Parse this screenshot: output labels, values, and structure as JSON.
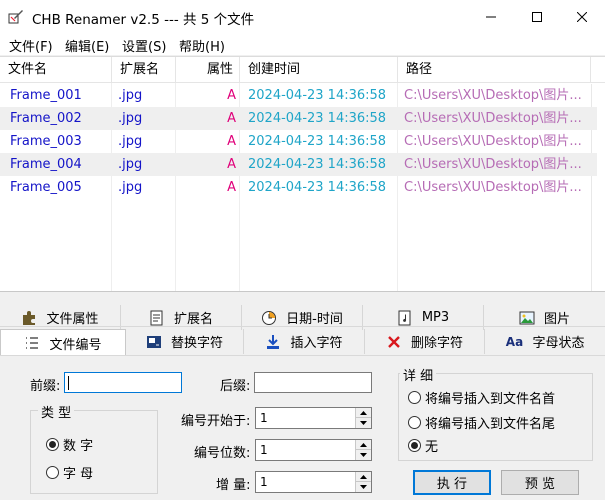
{
  "window": {
    "title": "CHB Renamer v2.5 --- 共 5 个文件"
  },
  "menu": {
    "items": [
      "文件(F)",
      "编辑(E)",
      "设置(S)",
      "帮助(H)"
    ]
  },
  "list": {
    "columns": [
      "文件名",
      "扩展名",
      "属性",
      "创建时间",
      "路径"
    ],
    "rows": [
      {
        "name": "Frame_001",
        "ext": ".jpg",
        "attr": "A",
        "time": "2024-04-23 14:36:58",
        "path": "C:\\Users\\XU\\Desktop\\图片..."
      },
      {
        "name": "Frame_002",
        "ext": ".jpg",
        "attr": "A",
        "time": "2024-04-23 14:36:58",
        "path": "C:\\Users\\XU\\Desktop\\图片..."
      },
      {
        "name": "Frame_003",
        "ext": ".jpg",
        "attr": "A",
        "time": "2024-04-23 14:36:58",
        "path": "C:\\Users\\XU\\Desktop\\图片..."
      },
      {
        "name": "Frame_004",
        "ext": ".jpg",
        "attr": "A",
        "time": "2024-04-23 14:36:58",
        "path": "C:\\Users\\XU\\Desktop\\图片..."
      },
      {
        "name": "Frame_005",
        "ext": ".jpg",
        "attr": "A",
        "time": "2024-04-23 14:36:58",
        "path": "C:\\Users\\XU\\Desktop\\图片..."
      }
    ]
  },
  "tabs": {
    "row1": [
      {
        "label": "文件属性",
        "icon": "puzzle-icon"
      },
      {
        "label": "扩展名",
        "icon": "document-edit-icon"
      },
      {
        "label": "日期-时间",
        "icon": "clock-icon"
      },
      {
        "label": "MP3",
        "icon": "music-file-icon"
      },
      {
        "label": "图片",
        "icon": "image-icon"
      }
    ],
    "row2": [
      {
        "label": "文件编号",
        "icon": "numbered-list-icon",
        "active": true
      },
      {
        "label": "替换字符",
        "icon": "replace-icon"
      },
      {
        "label": "插入字符",
        "icon": "insert-down-icon"
      },
      {
        "label": "删除字符",
        "icon": "delete-x-icon"
      },
      {
        "label": "字母状态",
        "icon": "letter-case-icon",
        "glyph": "Aa"
      }
    ]
  },
  "numbering": {
    "prefix_label": "前缀:",
    "prefix_value": "",
    "suffix_label": "后缀:",
    "suffix_value": "",
    "type_group_title": "类 型",
    "type_options": [
      "数 字",
      "字 母"
    ],
    "type_selected": "数 字",
    "start_label": "编号开始于:",
    "start_value": "1",
    "digits_label": "编号位数:",
    "digits_value": "1",
    "step_label": "增 量:",
    "step_value": "1",
    "detail_group_title": "详 细",
    "detail_options": [
      "将编号插入到文件名首",
      "将编号插入到文件名尾",
      "无"
    ],
    "detail_selected": "无",
    "execute_label": "执 行",
    "preview_label": "预 览"
  },
  "colors": {
    "name_text": "#1414c8",
    "attr_text": "#e0007a",
    "time_text": "#1fa5c8",
    "path_text": "#b66cb5",
    "focus_border": "#0078d7"
  }
}
